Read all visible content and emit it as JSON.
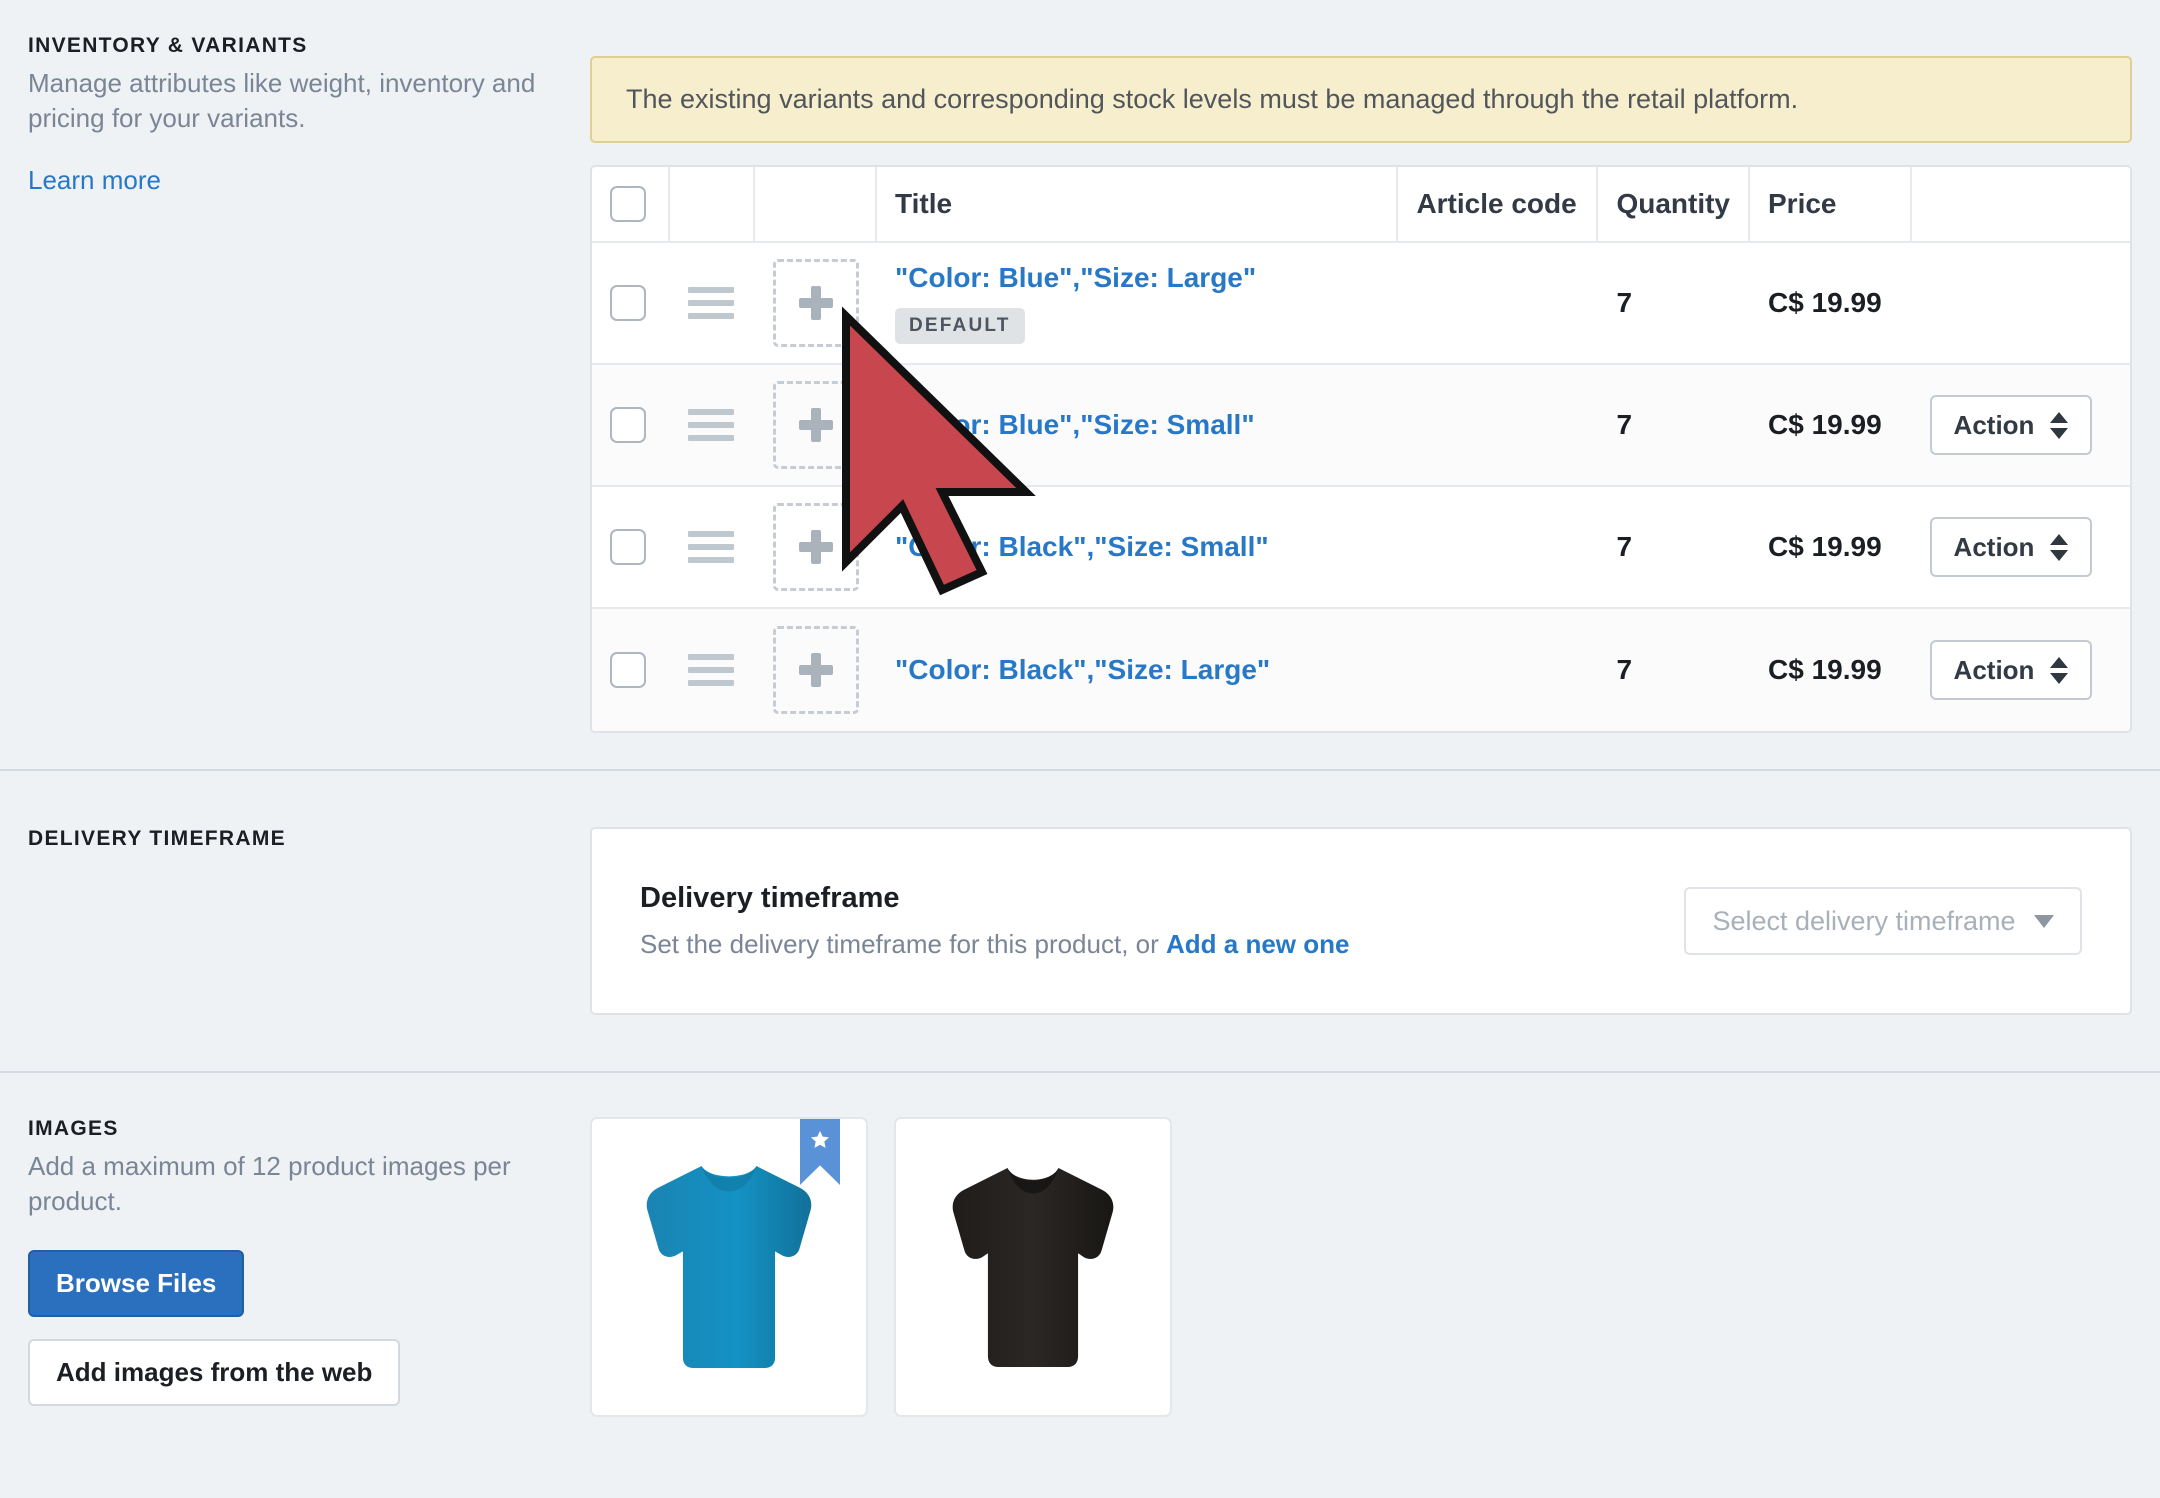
{
  "inventory": {
    "section_title": "INVENTORY & VARIANTS",
    "section_desc": "Manage attributes like weight, inventory and pricing for your variants.",
    "learn_more": "Learn more",
    "notice": "The existing variants and corresponding stock levels must be managed through the retail platform.",
    "table": {
      "headers": {
        "title": "Title",
        "article_code": "Article code",
        "quantity": "Quantity",
        "price": "Price"
      },
      "rows": [
        {
          "title": "\"Color: Blue\",\"Size: Large\"",
          "badge": "DEFAULT",
          "article_code": "",
          "quantity": "7",
          "price": "C$ 19.99",
          "action_label": ""
        },
        {
          "title": "\"Color: Blue\",\"Size: Small\"",
          "badge": "",
          "article_code": "",
          "quantity": "7",
          "price": "C$ 19.99",
          "action_label": "Action"
        },
        {
          "title": "\"Color: Black\",\"Size: Small\"",
          "badge": "",
          "article_code": "",
          "quantity": "7",
          "price": "C$ 19.99",
          "action_label": "Action"
        },
        {
          "title": "\"Color: Black\",\"Size: Large\"",
          "badge": "",
          "article_code": "",
          "quantity": "7",
          "price": "C$ 19.99",
          "action_label": "Action"
        }
      ]
    }
  },
  "delivery": {
    "section_title": "DELIVERY TIMEFRAME",
    "card_title": "Delivery timeframe",
    "card_sub_prefix": "Set the delivery timeframe for this product, or ",
    "card_sub_link": "Add a new one",
    "select_placeholder": "Select delivery timeframe"
  },
  "images": {
    "section_title": "IMAGES",
    "section_desc": "Add a maximum of 12 product images per product.",
    "browse_label": "Browse Files",
    "web_label": "Add images from the web",
    "thumbnails": [
      {
        "alt": "blue-tshirt",
        "color": "#1789b8",
        "primary": true
      },
      {
        "alt": "black-tshirt",
        "color": "#231f1d",
        "primary": false
      }
    ]
  },
  "colors": {
    "accent": "#2878c8",
    "notice_bg": "#f6eecd",
    "notice_border": "#e0cf95",
    "page_bg": "#eef2f5",
    "cursor": "#c8474f"
  }
}
